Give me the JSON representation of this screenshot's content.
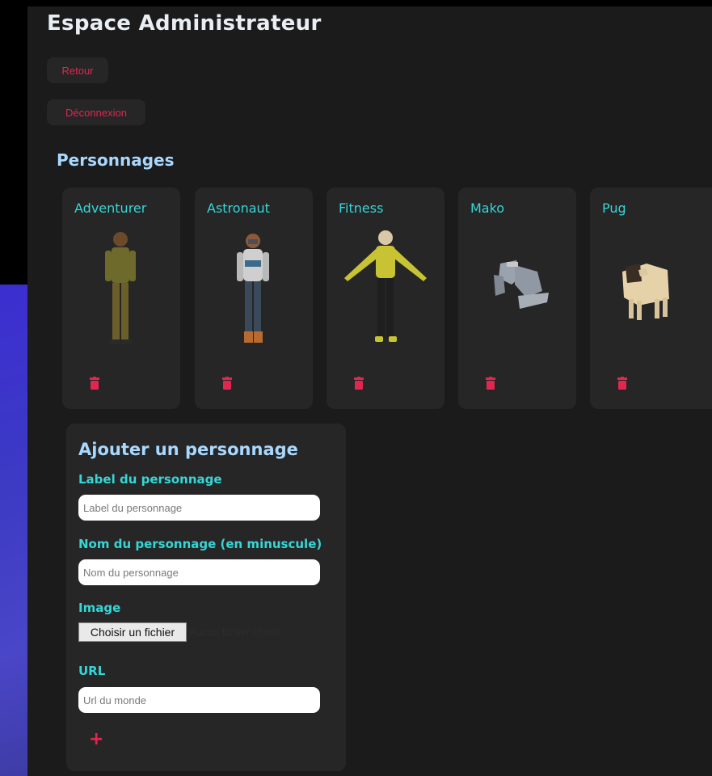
{
  "header": {
    "title": "Espace Administrateur"
  },
  "nav": {
    "back_label": "Retour",
    "logout_label": "Déconnexion"
  },
  "characters": {
    "section_title": "Personnages",
    "items": [
      {
        "label": "Adventurer"
      },
      {
        "label": "Astronaut"
      },
      {
        "label": "Fitness"
      },
      {
        "label": "Mako"
      },
      {
        "label": "Pug"
      }
    ]
  },
  "form": {
    "title": "Ajouter un personnage",
    "label_field": {
      "label": "Label du personnage",
      "placeholder": "Label du personnage"
    },
    "name_field": {
      "label": "Nom du personnage (en minuscule)",
      "placeholder": "Nom du personnage"
    },
    "image_field": {
      "label": "Image",
      "button": "Choisir un fichier",
      "status": "Aucun fichier choisi"
    },
    "url_field": {
      "label": "URL",
      "placeholder": "Url du monde"
    },
    "add_label": "+"
  },
  "colors": {
    "accent": "#e1264f",
    "label": "#37d6d6",
    "heading": "#a9d8ff",
    "panel": "#1b1b1c",
    "card": "#262627"
  }
}
